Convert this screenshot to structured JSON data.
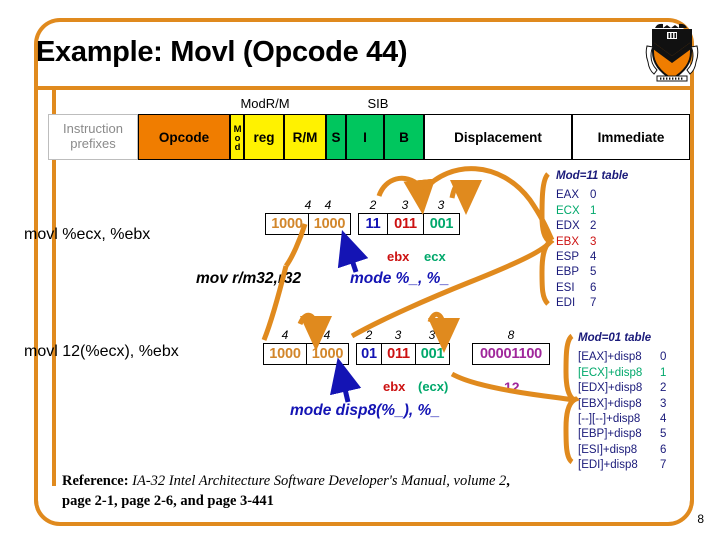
{
  "slide": {
    "title": "Example: Movl (Opcode 44)",
    "number": "8",
    "logo_alt": "princeton-shield"
  },
  "format_bar": {
    "group_labels": [
      {
        "text": "ModR/M"
      },
      {
        "text": "SIB"
      }
    ],
    "cells": [
      {
        "label": "Instruction prefixes",
        "style": "white",
        "lines": [
          "Instruction",
          "prefixes"
        ]
      },
      {
        "label": "Opcode",
        "style": "orange"
      },
      {
        "label": "Mod",
        "style": "yellow-vert"
      },
      {
        "label": "reg",
        "style": "yellow"
      },
      {
        "label": "R/M",
        "style": "yellow"
      },
      {
        "label": "S",
        "style": "green"
      },
      {
        "label": "I",
        "style": "green"
      },
      {
        "label": "B",
        "style": "green"
      },
      {
        "label": "Displacement",
        "style": "plain"
      },
      {
        "label": "Immediate",
        "style": "plain"
      }
    ]
  },
  "row1": {
    "asm": "movl %ecx, %ebx",
    "bit_widths": [
      "4",
      "4",
      "2",
      "3",
      "3"
    ],
    "fields": [
      {
        "bits": "1000",
        "color": "#D2862B"
      },
      {
        "bits": "1000",
        "color": "#D2862B"
      },
      {
        "bits": "11",
        "color": "#1414B4"
      },
      {
        "bits": "011",
        "color": "#CC1111"
      },
      {
        "bits": "001",
        "color": "#00A86B"
      }
    ],
    "annot_reg1": "ebx",
    "annot_reg2": "ecx",
    "annot_opcode": "mov r/m32,r32",
    "annot_mode": "mode %_, %_"
  },
  "row2": {
    "asm": "movl 12(%ecx), %ebx",
    "bit_widths": [
      "4",
      "4",
      "2",
      "3",
      "3",
      "8"
    ],
    "fields": [
      {
        "bits": "1000",
        "color": "#D2862B"
      },
      {
        "bits": "1000",
        "color": "#D2862B"
      },
      {
        "bits": "01",
        "color": "#1414B4"
      },
      {
        "bits": "011",
        "color": "#CC1111"
      },
      {
        "bits": "001",
        "color": "#00A86B"
      },
      {
        "bits": "00001100",
        "color": "#A0279B"
      }
    ],
    "annot_reg1": "ebx",
    "annot_reg2": "(ecx)",
    "annot_disp": "12",
    "annot_mode": "mode disp8(%_), %_"
  },
  "table_mod11": {
    "header": "Mod=11 table",
    "rows": [
      {
        "name": "EAX",
        "num": "0",
        "color": "#1a1a7a"
      },
      {
        "name": "ECX",
        "num": "1",
        "color": "#00A86B"
      },
      {
        "name": "EDX",
        "num": "2",
        "color": "#1a1a7a"
      },
      {
        "name": "EBX",
        "num": "3",
        "color": "#CC1111"
      },
      {
        "name": "ESP",
        "num": "4",
        "color": "#1a1a7a"
      },
      {
        "name": "EBP",
        "num": "5",
        "color": "#1a1a7a"
      },
      {
        "name": "ESI",
        "num": "6",
        "color": "#1a1a7a"
      },
      {
        "name": "EDI",
        "num": "7",
        "color": "#1a1a7a"
      }
    ]
  },
  "table_mod01": {
    "header": "Mod=01 table",
    "rows": [
      {
        "name": "[EAX]+disp8",
        "num": "0",
        "color": "#1a1a7a"
      },
      {
        "name": "[ECX]+disp8",
        "num": "1",
        "color": "#00A86B"
      },
      {
        "name": "[EDX]+disp8",
        "num": "2",
        "color": "#1a1a7a"
      },
      {
        "name": "[EBX]+disp8",
        "num": "3",
        "color": "#1a1a7a"
      },
      {
        "name": "[--][--]+disp8",
        "num": "4",
        "color": "#1a1a7a"
      },
      {
        "name": "[EBP]+disp8",
        "num": "5",
        "color": "#1a1a7a"
      },
      {
        "name": "[ESI]+disp8",
        "num": "6",
        "color": "#1a1a7a"
      },
      {
        "name": "[EDI]+disp8",
        "num": "7",
        "color": "#1a1a7a"
      }
    ]
  },
  "reference": {
    "label": "Reference:",
    "work": "IA-32 Intel Architecture Software Developer's Manual, volume 2",
    "pages": ", page 2-1, page 2-6, and page 3-441"
  },
  "colors": {
    "frame": "#E08A1E",
    "opcode": "#F07D00",
    "modrm": "#FFF200",
    "sib": "#00C65E",
    "arrow": "#E08A1E"
  }
}
